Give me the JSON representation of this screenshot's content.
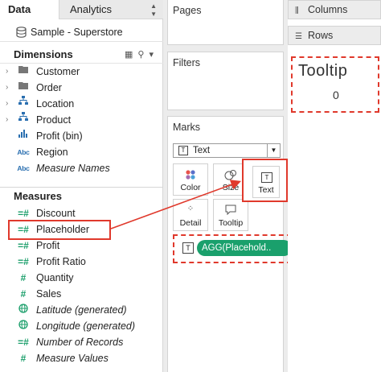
{
  "tabs": {
    "data": "Data",
    "analytics": "Analytics"
  },
  "source": {
    "name": "Sample - Superstore"
  },
  "dimensions": {
    "header": "Dimensions",
    "fields": [
      {
        "label": "Customer",
        "icon": "folder-icon"
      },
      {
        "label": "Order",
        "icon": "folder-icon"
      },
      {
        "label": "Location",
        "icon": "hierarchy-icon"
      },
      {
        "label": "Product",
        "icon": "hierarchy-icon"
      },
      {
        "label": "Profit (bin)",
        "icon": "bin-icon"
      },
      {
        "label": "Region",
        "icon": "abc-icon",
        "icon_text": "Abc"
      },
      {
        "label": "Measure Names",
        "icon": "abc-icon",
        "icon_text": "Abc"
      }
    ]
  },
  "measures": {
    "header": "Measures",
    "fields": [
      {
        "label": "Discount"
      },
      {
        "label": "Placeholder"
      },
      {
        "label": "Profit"
      },
      {
        "label": "Profit Ratio"
      },
      {
        "label": "Quantity"
      },
      {
        "label": "Sales"
      },
      {
        "label": "Latitude (generated)"
      },
      {
        "label": "Longitude (generated)"
      },
      {
        "label": "Number of Records"
      },
      {
        "label": "Measure Values"
      }
    ]
  },
  "cards": {
    "pages": "Pages",
    "filters": "Filters",
    "marks": "Marks"
  },
  "marks": {
    "type_label": "Text",
    "buttons": {
      "color": "Color",
      "size": "Size",
      "text": "Text",
      "detail": "Detail",
      "tooltip": "Tooltip"
    },
    "pill": "AGG(Placehold.."
  },
  "shelves": {
    "columns": "Columns",
    "rows": "Rows"
  },
  "tooltip_preview": {
    "title": "Tooltip",
    "value": "0"
  },
  "colors": {
    "highlight": "#e0392c",
    "measure_pill": "#1aa06c",
    "measure_icon": "#1a9e6a",
    "dimension_icon": "#2a6fb0"
  }
}
